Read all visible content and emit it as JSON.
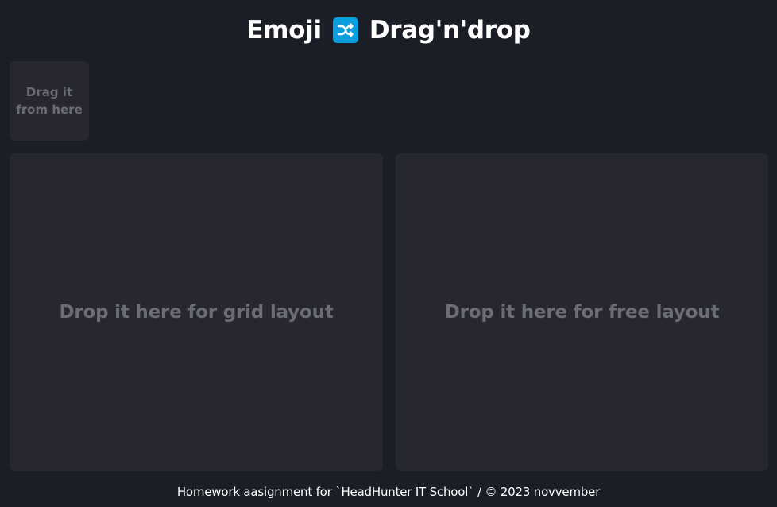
{
  "header": {
    "title_left": "Emoji",
    "icon": "shuffle-icon",
    "title_right": "Drag'n'drop",
    "icon_color": "#0b9fe0"
  },
  "drag_source": {
    "label": "Drag it from here"
  },
  "drop_zones": [
    {
      "label": "Drop it here for grid layout"
    },
    {
      "label": "Drop it here for free layout"
    }
  ],
  "footer": {
    "text": "Homework aasignment for `HeadHunter IT School` / © 2023 novvember"
  },
  "colors": {
    "background": "#1b1e27",
    "panel": "#262730",
    "muted_text": "#6c6d74",
    "title_text": "#ffffff"
  }
}
